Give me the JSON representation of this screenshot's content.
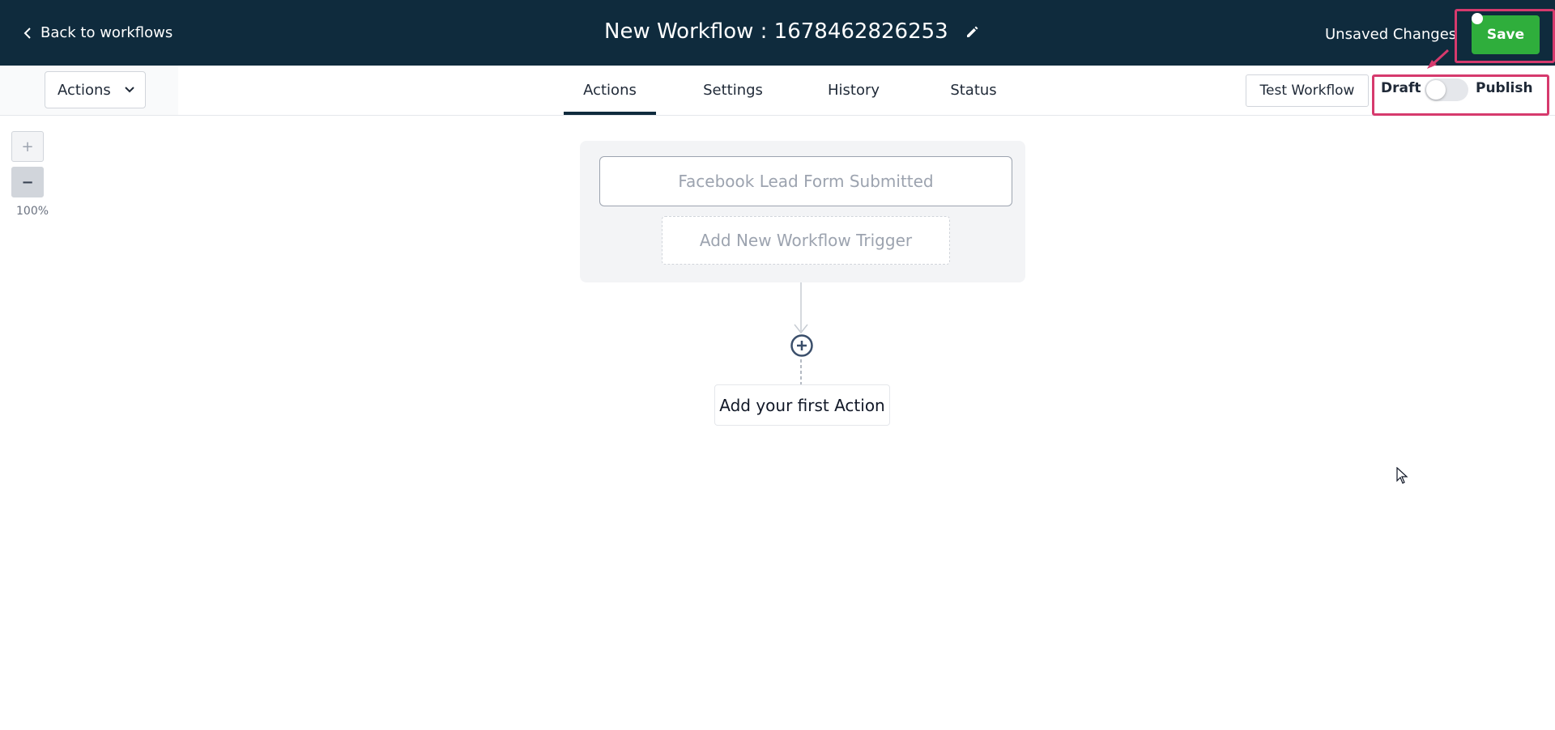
{
  "header": {
    "back_label": "Back to workflows",
    "workflow_title": "New Workflow : 1678462826253",
    "unsaved_label": "Unsaved Changes",
    "save_label": "Save"
  },
  "toolbar": {
    "actions_dropdown_label": "Actions",
    "tabs": [
      {
        "label": "Actions",
        "active": true
      },
      {
        "label": "Settings",
        "active": false
      },
      {
        "label": "History",
        "active": false
      },
      {
        "label": "Status",
        "active": false
      }
    ],
    "test_workflow_label": "Test Workflow",
    "draft_label": "Draft",
    "publish_label": "Publish",
    "publish_toggle_on": false
  },
  "zoom": {
    "zoom_in_label": "+",
    "zoom_out_label": "−",
    "level": "100%"
  },
  "canvas": {
    "trigger_label": "Facebook Lead Form Submitted",
    "add_trigger_label": "Add New Workflow Trigger",
    "first_action_label": "Add your first Action"
  },
  "colors": {
    "header_bg": "#0f2b3d",
    "save_green": "#2fae3c",
    "highlight_pink": "#d63a6d"
  },
  "icons": {
    "back": "chevron-left-icon",
    "edit": "pencil-icon",
    "dropdown": "chevron-down-icon",
    "add_action": "plus-circle-icon"
  }
}
